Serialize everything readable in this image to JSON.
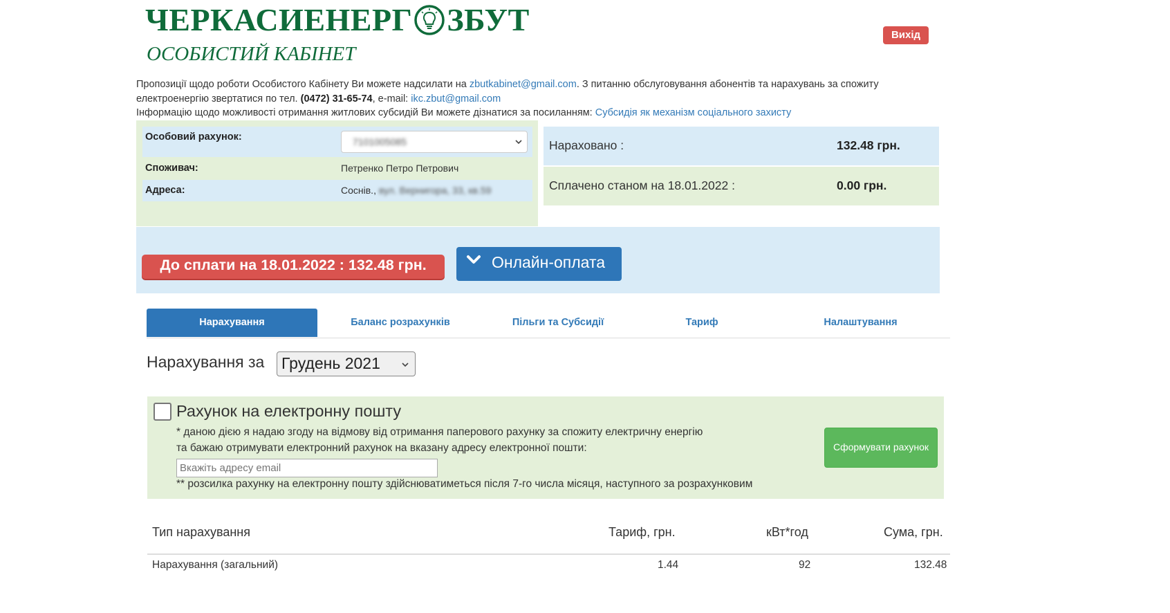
{
  "header": {
    "logo_left": "ЧЕРКАСИЕНЕРГ",
    "logo_right": "ЗБУТ",
    "subtitle": "ОСОБИСТИЙ КАБІНЕТ",
    "logout": "Вихід"
  },
  "info": {
    "p1": "Пропозиції щодо роботи Особистого Кабінету Ви можете надсилати на ",
    "email1": "zbutkabinet@gmail.com",
    "p2": ". З питанню обслуговування абонентів та нарахувань за спожиту електроенергію звертатися по тел. ",
    "phone": "(0472) 31-65-74",
    "p3": ", e-mail: ",
    "email2": "ikc.zbut@gmail.com",
    "p4": "Інформацію щодо можливості отримання житлових субсидій Ви можете дізнатися за посиланням: ",
    "subsidy_link": "Субсидія як механізм соціального захисту"
  },
  "account": {
    "account_label": "Особовий рахунок:",
    "account_value": "7101005085",
    "consumer_label": "Споживач:",
    "consumer_value": "Петренко Петро Петрович",
    "address_label": "Адреса:",
    "address_city": "Соснів., ",
    "address_street": "вул. Вернигора, 33, кв.59"
  },
  "summary": {
    "accrued_label": "Нараховано :",
    "accrued_value": "132.48 грн.",
    "paid_label": "Сплачено станом на 18.01.2022 :",
    "paid_value": "0.00 грн."
  },
  "payment": {
    "due": "До сплати на 18.01.2022 : 132.48 грн.",
    "online": "Онлайн-оплата"
  },
  "tabs": [
    {
      "label": "Нарахування",
      "active": true
    },
    {
      "label": "Баланс розрахунків",
      "active": false
    },
    {
      "label": "Пільги та Субсидії",
      "active": false
    },
    {
      "label": "Тариф",
      "active": false
    },
    {
      "label": "Налаштування",
      "active": false
    }
  ],
  "period": {
    "label": "Нарахування за",
    "selected": "Грудень 2021"
  },
  "email_bill": {
    "title": "Рахунок на електронну пошту",
    "note1": "* даною дією я надаю згоду на відмову від отримання паперового рахунку за спожиту електричну енергію",
    "note2": "та бажаю отримувати електронний рахунок на вказану адресу електронної пошти:",
    "placeholder": "Вкажіть адресу email",
    "note3": "** розсилка рахунку на електронну пошту здійснюватиметься після 7-го числа місяця, наступного за розрахунковим",
    "button": "Сформувати рахунок"
  },
  "table": {
    "headers": [
      "Тип нарахування",
      "Тариф, грн.",
      "кВт*год",
      "Сума, грн."
    ],
    "rows": [
      [
        "Нарахування (загальний)",
        "1.44",
        "92",
        "132.48"
      ]
    ]
  },
  "colors": {
    "brand_green": "#0f6b3a",
    "danger": "#d9534f",
    "primary": "#2e76b8",
    "success": "#5cb85c",
    "panel_blue": "#d9ebf7",
    "panel_green": "#e4f0d9"
  }
}
